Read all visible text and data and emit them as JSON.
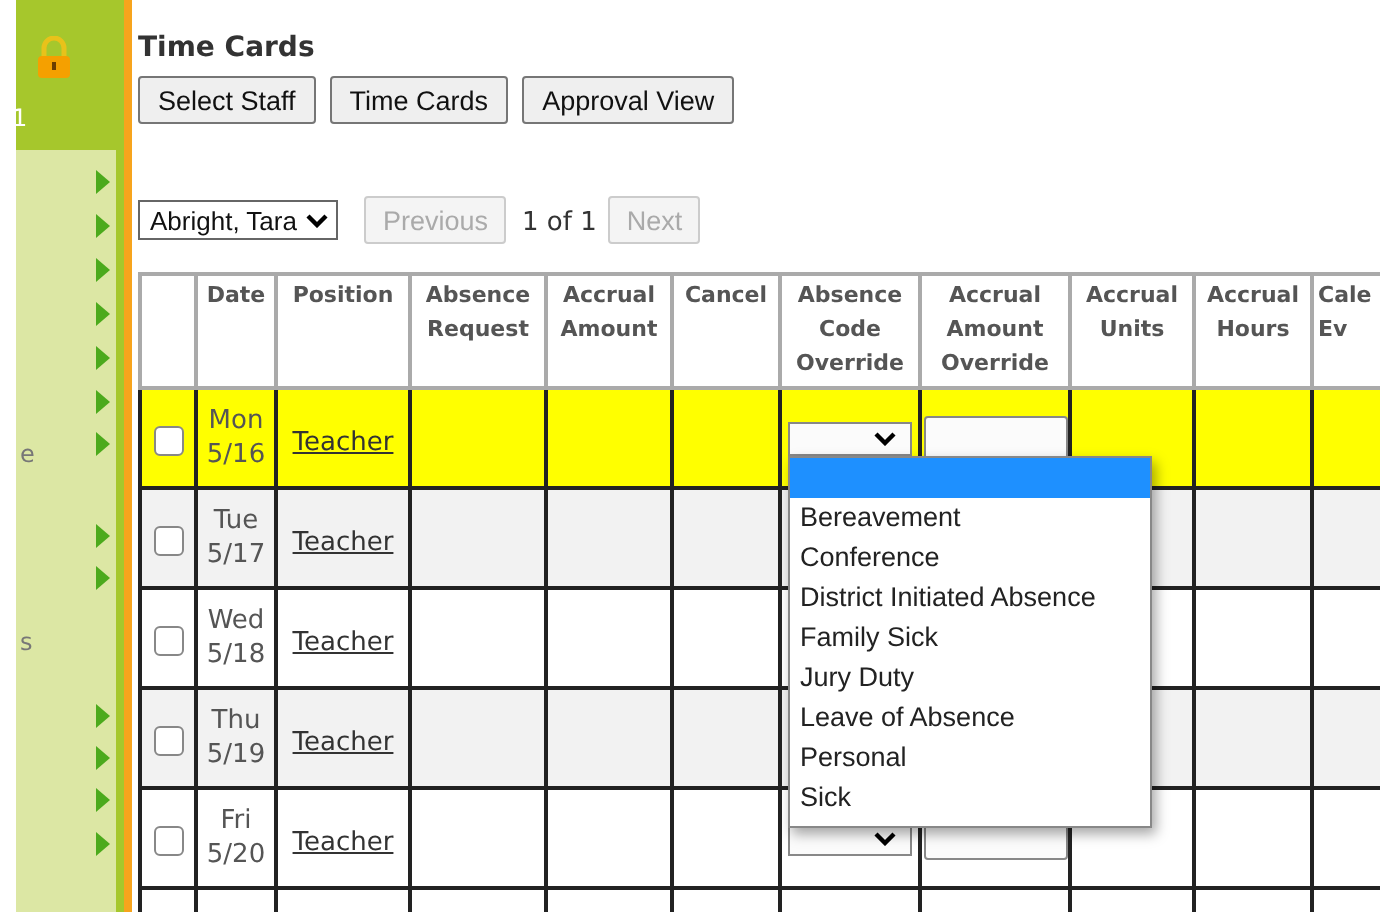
{
  "sidebar": {
    "fragments": [
      {
        "text": "1",
        "kind": "top"
      },
      {
        "text": "e",
        "kind": "item"
      },
      {
        "text": "s",
        "kind": "item"
      }
    ]
  },
  "title": "Time Cards",
  "buttons": [
    "Select Staff",
    "Time Cards",
    "Approval View"
  ],
  "nav": {
    "staff": "Abright, Tara",
    "previous": {
      "label": "Previous",
      "disabled": true
    },
    "page": "1 of 1",
    "next": {
      "label": "Next",
      "disabled": true
    }
  },
  "table": {
    "columns": [
      "Date",
      "Position",
      "Absence Request",
      "Accrual Amount",
      "Cancel",
      "Absence Code Override",
      "Accrual Amount Override",
      "Accrual Units",
      "Accrual Hours",
      "Cale Ev"
    ],
    "rows": [
      {
        "day": "Mon",
        "date": "5/16",
        "position": "Teacher",
        "checked": false,
        "highlighted": true
      },
      {
        "day": "Tue",
        "date": "5/17",
        "position": "Teacher",
        "checked": false,
        "highlighted": false
      },
      {
        "day": "Wed",
        "date": "5/18",
        "position": "Teacher",
        "checked": false,
        "highlighted": false
      },
      {
        "day": "Thu",
        "date": "5/19",
        "position": "Teacher",
        "checked": false,
        "highlighted": false
      },
      {
        "day": "Fri",
        "date": "5/20",
        "position": "Teacher",
        "checked": false,
        "highlighted": false
      }
    ]
  },
  "dropdown": {
    "blank_option_selected": true,
    "options": [
      {
        "label": "Bereavement",
        "selected": false
      },
      {
        "label": "Conference",
        "selected": false
      },
      {
        "label": "District Initiated Absence",
        "selected": false
      },
      {
        "label": "Family Sick",
        "selected": false
      },
      {
        "label": "Jury Duty",
        "selected": false
      },
      {
        "label": "Leave of Absence",
        "selected": false
      },
      {
        "label": "Personal",
        "selected": false
      },
      {
        "label": "Sick",
        "selected": false
      }
    ]
  }
}
